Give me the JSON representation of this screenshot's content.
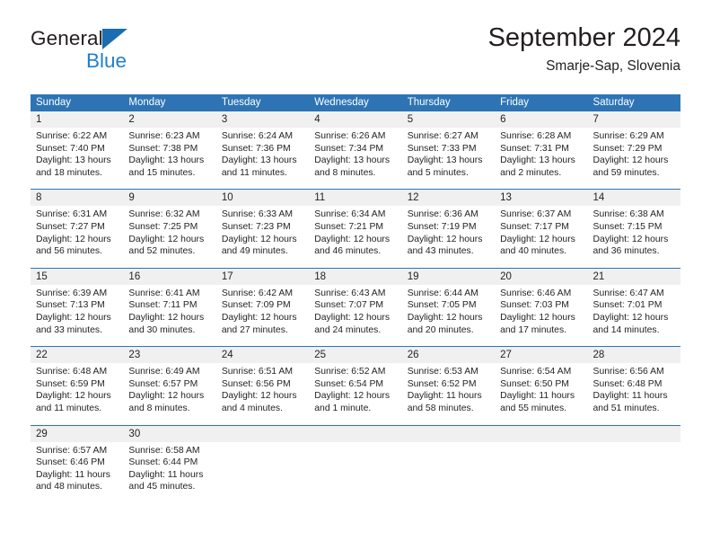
{
  "brand": {
    "name_part1": "General",
    "name_part2": "Blue",
    "triangle_color": "#1b6cb0",
    "blue_color": "#2080d0"
  },
  "header": {
    "title": "September 2024",
    "subtitle": "Smarje-Sap, Slovenia"
  },
  "theme": {
    "header_band": "#2e74b5",
    "daynum_band": "#f0f0f0",
    "text": "#231f20"
  },
  "weekdays": [
    "Sunday",
    "Monday",
    "Tuesday",
    "Wednesday",
    "Thursday",
    "Friday",
    "Saturday"
  ],
  "weeks": [
    [
      {
        "day": "1",
        "sunrise": "Sunrise: 6:22 AM",
        "sunset": "Sunset: 7:40 PM",
        "daylight_line1": "Daylight: 13 hours",
        "daylight_line2": "and 18 minutes."
      },
      {
        "day": "2",
        "sunrise": "Sunrise: 6:23 AM",
        "sunset": "Sunset: 7:38 PM",
        "daylight_line1": "Daylight: 13 hours",
        "daylight_line2": "and 15 minutes."
      },
      {
        "day": "3",
        "sunrise": "Sunrise: 6:24 AM",
        "sunset": "Sunset: 7:36 PM",
        "daylight_line1": "Daylight: 13 hours",
        "daylight_line2": "and 11 minutes."
      },
      {
        "day": "4",
        "sunrise": "Sunrise: 6:26 AM",
        "sunset": "Sunset: 7:34 PM",
        "daylight_line1": "Daylight: 13 hours",
        "daylight_line2": "and 8 minutes."
      },
      {
        "day": "5",
        "sunrise": "Sunrise: 6:27 AM",
        "sunset": "Sunset: 7:33 PM",
        "daylight_line1": "Daylight: 13 hours",
        "daylight_line2": "and 5 minutes."
      },
      {
        "day": "6",
        "sunrise": "Sunrise: 6:28 AM",
        "sunset": "Sunset: 7:31 PM",
        "daylight_line1": "Daylight: 13 hours",
        "daylight_line2": "and 2 minutes."
      },
      {
        "day": "7",
        "sunrise": "Sunrise: 6:29 AM",
        "sunset": "Sunset: 7:29 PM",
        "daylight_line1": "Daylight: 12 hours",
        "daylight_line2": "and 59 minutes."
      }
    ],
    [
      {
        "day": "8",
        "sunrise": "Sunrise: 6:31 AM",
        "sunset": "Sunset: 7:27 PM",
        "daylight_line1": "Daylight: 12 hours",
        "daylight_line2": "and 56 minutes."
      },
      {
        "day": "9",
        "sunrise": "Sunrise: 6:32 AM",
        "sunset": "Sunset: 7:25 PM",
        "daylight_line1": "Daylight: 12 hours",
        "daylight_line2": "and 52 minutes."
      },
      {
        "day": "10",
        "sunrise": "Sunrise: 6:33 AM",
        "sunset": "Sunset: 7:23 PM",
        "daylight_line1": "Daylight: 12 hours",
        "daylight_line2": "and 49 minutes."
      },
      {
        "day": "11",
        "sunrise": "Sunrise: 6:34 AM",
        "sunset": "Sunset: 7:21 PM",
        "daylight_line1": "Daylight: 12 hours",
        "daylight_line2": "and 46 minutes."
      },
      {
        "day": "12",
        "sunrise": "Sunrise: 6:36 AM",
        "sunset": "Sunset: 7:19 PM",
        "daylight_line1": "Daylight: 12 hours",
        "daylight_line2": "and 43 minutes."
      },
      {
        "day": "13",
        "sunrise": "Sunrise: 6:37 AM",
        "sunset": "Sunset: 7:17 PM",
        "daylight_line1": "Daylight: 12 hours",
        "daylight_line2": "and 40 minutes."
      },
      {
        "day": "14",
        "sunrise": "Sunrise: 6:38 AM",
        "sunset": "Sunset: 7:15 PM",
        "daylight_line1": "Daylight: 12 hours",
        "daylight_line2": "and 36 minutes."
      }
    ],
    [
      {
        "day": "15",
        "sunrise": "Sunrise: 6:39 AM",
        "sunset": "Sunset: 7:13 PM",
        "daylight_line1": "Daylight: 12 hours",
        "daylight_line2": "and 33 minutes."
      },
      {
        "day": "16",
        "sunrise": "Sunrise: 6:41 AM",
        "sunset": "Sunset: 7:11 PM",
        "daylight_line1": "Daylight: 12 hours",
        "daylight_line2": "and 30 minutes."
      },
      {
        "day": "17",
        "sunrise": "Sunrise: 6:42 AM",
        "sunset": "Sunset: 7:09 PM",
        "daylight_line1": "Daylight: 12 hours",
        "daylight_line2": "and 27 minutes."
      },
      {
        "day": "18",
        "sunrise": "Sunrise: 6:43 AM",
        "sunset": "Sunset: 7:07 PM",
        "daylight_line1": "Daylight: 12 hours",
        "daylight_line2": "and 24 minutes."
      },
      {
        "day": "19",
        "sunrise": "Sunrise: 6:44 AM",
        "sunset": "Sunset: 7:05 PM",
        "daylight_line1": "Daylight: 12 hours",
        "daylight_line2": "and 20 minutes."
      },
      {
        "day": "20",
        "sunrise": "Sunrise: 6:46 AM",
        "sunset": "Sunset: 7:03 PM",
        "daylight_line1": "Daylight: 12 hours",
        "daylight_line2": "and 17 minutes."
      },
      {
        "day": "21",
        "sunrise": "Sunrise: 6:47 AM",
        "sunset": "Sunset: 7:01 PM",
        "daylight_line1": "Daylight: 12 hours",
        "daylight_line2": "and 14 minutes."
      }
    ],
    [
      {
        "day": "22",
        "sunrise": "Sunrise: 6:48 AM",
        "sunset": "Sunset: 6:59 PM",
        "daylight_line1": "Daylight: 12 hours",
        "daylight_line2": "and 11 minutes."
      },
      {
        "day": "23",
        "sunrise": "Sunrise: 6:49 AM",
        "sunset": "Sunset: 6:57 PM",
        "daylight_line1": "Daylight: 12 hours",
        "daylight_line2": "and 8 minutes."
      },
      {
        "day": "24",
        "sunrise": "Sunrise: 6:51 AM",
        "sunset": "Sunset: 6:56 PM",
        "daylight_line1": "Daylight: 12 hours",
        "daylight_line2": "and 4 minutes."
      },
      {
        "day": "25",
        "sunrise": "Sunrise: 6:52 AM",
        "sunset": "Sunset: 6:54 PM",
        "daylight_line1": "Daylight: 12 hours",
        "daylight_line2": "and 1 minute."
      },
      {
        "day": "26",
        "sunrise": "Sunrise: 6:53 AM",
        "sunset": "Sunset: 6:52 PM",
        "daylight_line1": "Daylight: 11 hours",
        "daylight_line2": "and 58 minutes."
      },
      {
        "day": "27",
        "sunrise": "Sunrise: 6:54 AM",
        "sunset": "Sunset: 6:50 PM",
        "daylight_line1": "Daylight: 11 hours",
        "daylight_line2": "and 55 minutes."
      },
      {
        "day": "28",
        "sunrise": "Sunrise: 6:56 AM",
        "sunset": "Sunset: 6:48 PM",
        "daylight_line1": "Daylight: 11 hours",
        "daylight_line2": "and 51 minutes."
      }
    ],
    [
      {
        "day": "29",
        "sunrise": "Sunrise: 6:57 AM",
        "sunset": "Sunset: 6:46 PM",
        "daylight_line1": "Daylight: 11 hours",
        "daylight_line2": "and 48 minutes."
      },
      {
        "day": "30",
        "sunrise": "Sunrise: 6:58 AM",
        "sunset": "Sunset: 6:44 PM",
        "daylight_line1": "Daylight: 11 hours",
        "daylight_line2": "and 45 minutes."
      },
      {
        "day": "",
        "sunrise": "",
        "sunset": "",
        "daylight_line1": "",
        "daylight_line2": ""
      },
      {
        "day": "",
        "sunrise": "",
        "sunset": "",
        "daylight_line1": "",
        "daylight_line2": ""
      },
      {
        "day": "",
        "sunrise": "",
        "sunset": "",
        "daylight_line1": "",
        "daylight_line2": ""
      },
      {
        "day": "",
        "sunrise": "",
        "sunset": "",
        "daylight_line1": "",
        "daylight_line2": ""
      },
      {
        "day": "",
        "sunrise": "",
        "sunset": "",
        "daylight_line1": "",
        "daylight_line2": ""
      }
    ]
  ]
}
